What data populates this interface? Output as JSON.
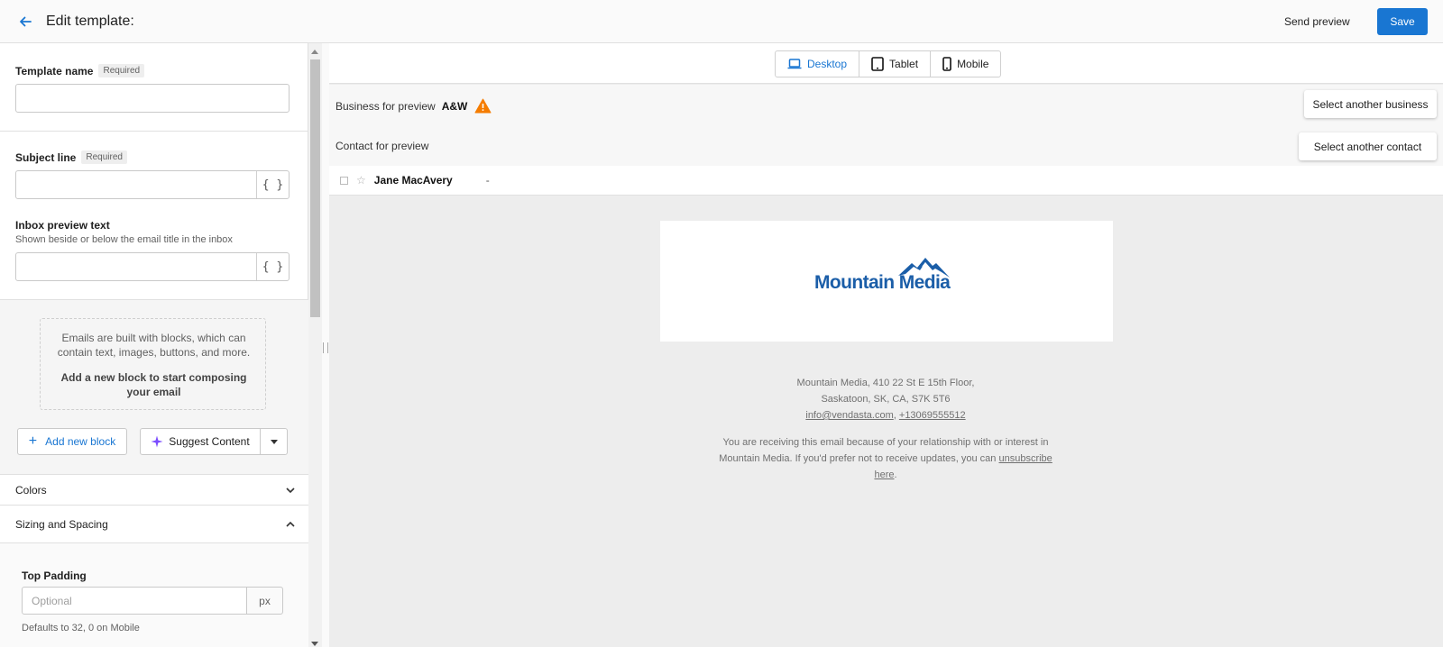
{
  "header": {
    "title": "Edit template:",
    "send_preview": "Send preview",
    "save": "Save"
  },
  "form": {
    "template_name": {
      "label": "Template name",
      "required": "Required",
      "value": ""
    },
    "subject_line": {
      "label": "Subject line",
      "required": "Required",
      "value": ""
    },
    "inbox_preview": {
      "label": "Inbox preview text",
      "hint": "Shown beside or below the email title in the inbox",
      "value": ""
    },
    "blocks_text": "Emails are built with blocks, which can contain text, images, buttons, and more.",
    "blocks_cta": "Add a new block to start composing your email",
    "add_block": "Add new block",
    "suggest_content": "Suggest Content",
    "sections": [
      "Colors",
      "Sizing and Spacing"
    ],
    "top_padding": {
      "label": "Top Padding",
      "placeholder": "Optional",
      "unit": "px",
      "hint": "Defaults to 32, 0 on Mobile"
    }
  },
  "preview": {
    "devices": [
      "Desktop",
      "Tablet",
      "Mobile"
    ],
    "active_device": "Desktop",
    "business_label": "Business for preview",
    "business_name": "A&W",
    "select_business": "Select another business",
    "contact_label": "Contact for preview",
    "select_contact": "Select another contact",
    "inbox_sender": "Jane MacAvery",
    "inbox_subject": "-",
    "logo_text": "Mountain Media",
    "address_line1": "Mountain Media, 410 22 St E 15th Floor,",
    "address_line2": "Saskatoon, SK, CA, S7K 5T6",
    "email": "info@vendasta.com",
    "separator": ", ",
    "phone": "+13069555512",
    "notice_part1": "You are receiving this email because of your relationship with or interest in Mountain Media. If you'd prefer not to receive updates, you can ",
    "unsubscribe": "unsubscribe here",
    "notice_end": "."
  },
  "colors": {
    "primary": "#1976d2",
    "warning": "#f57c00",
    "logo_blue": "#1b5ea8",
    "sparkle_purple": "#7c4dff"
  }
}
